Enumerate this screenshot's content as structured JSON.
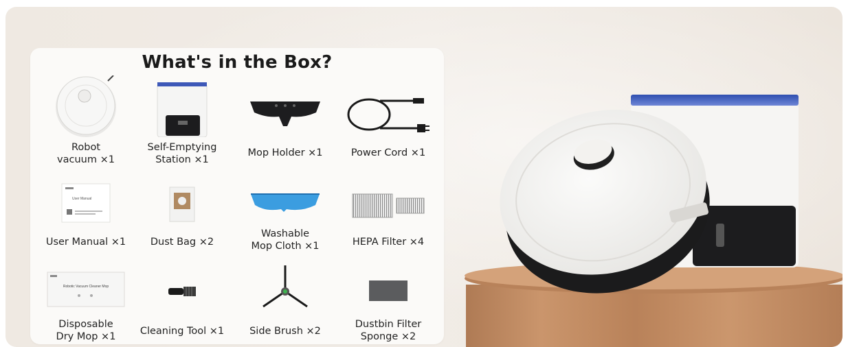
{
  "box_title": "What's in the Box?",
  "items": [
    {
      "label": "Robot\nvacuum ×1",
      "icon": "robot-vacuum-icon"
    },
    {
      "label": "Self-Emptying\nStation ×1",
      "icon": "station-icon"
    },
    {
      "label": "Mop Holder ×1",
      "icon": "mop-holder-icon"
    },
    {
      "label": "Power Cord ×1",
      "icon": "power-cord-icon"
    },
    {
      "label": "User Manual ×1",
      "icon": "user-manual-icon"
    },
    {
      "label": "Dust Bag ×2",
      "icon": "dust-bag-icon"
    },
    {
      "label": "Washable\nMop Cloth ×1",
      "icon": "mop-cloth-icon"
    },
    {
      "label": "HEPA Filter ×4",
      "icon": "hepa-filter-icon"
    },
    {
      "label": "Disposable\nDry Mop ×1",
      "icon": "dry-mop-icon"
    },
    {
      "label": "Cleaning Tool ×1",
      "icon": "cleaning-tool-icon"
    },
    {
      "label": "Side Brush ×2",
      "icon": "side-brush-icon"
    },
    {
      "label": "Dustbin Filter\nSponge ×2",
      "icon": "sponge-icon"
    }
  ],
  "manual_text": "User Manual",
  "dry_mop_text": "Robotic Vacuum Cleaner Mop",
  "colors": {
    "card": "#fbfaf8",
    "wall": "#efe9e2",
    "wood": "#c8926a",
    "mop_blue": "#3b9de0"
  }
}
